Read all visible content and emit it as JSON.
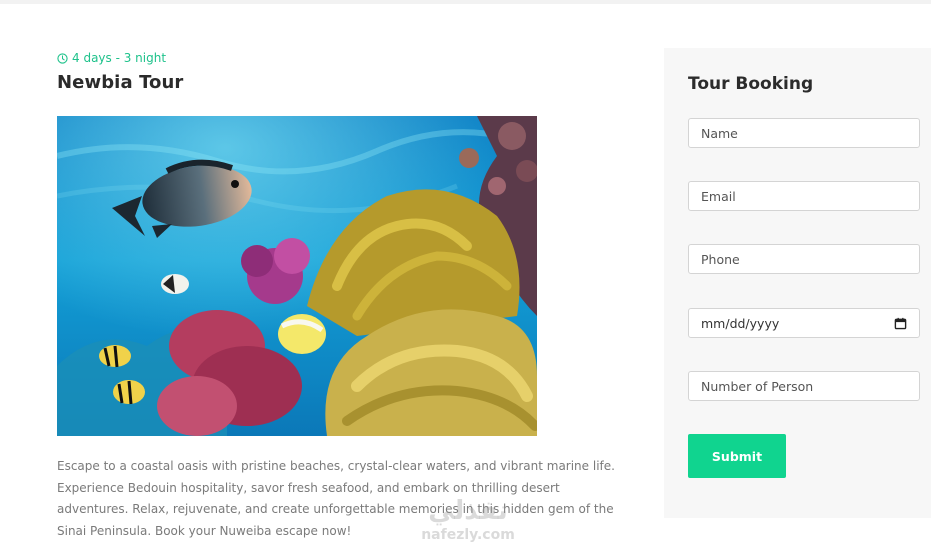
{
  "tour": {
    "duration": "4 days - 3 night",
    "title": "Newbia Tour",
    "description": "Escape to a coastal oasis with pristine beaches, crystal-clear waters, and vibrant marine life. Experience Bedouin hospitality, savor fresh seafood, and embark on thrilling desert adventures. Relax, rejuvenate, and create unforgettable memories in this hidden gem of the Sinai Peninsula. Book your Nuweiba escape now!"
  },
  "booking": {
    "title": "Tour Booking",
    "name_placeholder": "Name",
    "email_placeholder": "Email",
    "phone_placeholder": "Phone",
    "date_placeholder": "mm/dd/yyyy",
    "persons_placeholder": "Number of Person",
    "submit_label": "Submit"
  },
  "watermark": {
    "arabic": "نفذلي",
    "latin": "nafezly.com"
  },
  "icons": {
    "duration": "clock-icon",
    "date": "calendar-icon"
  },
  "colors": {
    "accent": "#10d48f",
    "duration_text": "#1ec28b",
    "panel_bg": "#f7f7f7"
  }
}
